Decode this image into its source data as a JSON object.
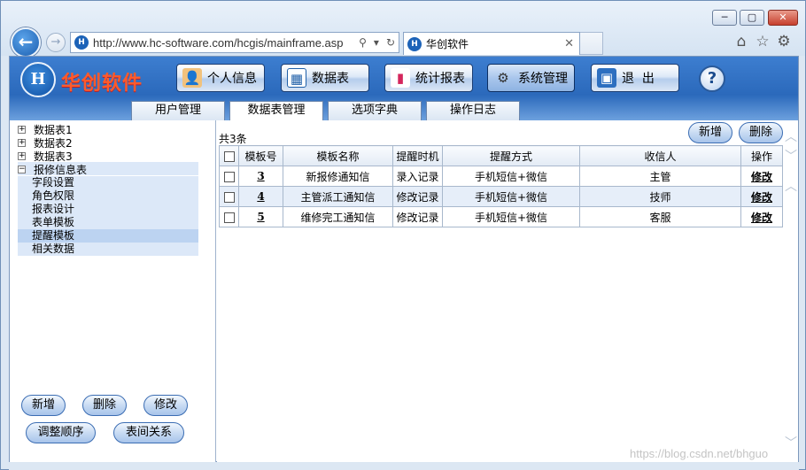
{
  "browser": {
    "url": "http://www.hc-software.com/hcgis/mainframe.asp",
    "favicon_text": "H",
    "tab_title": "华创软件",
    "tab_close": "✕",
    "window_controls": {
      "minimize": "─",
      "maximize": "▢",
      "close": "✕"
    },
    "icons": {
      "back": "←",
      "forward": "→",
      "search": "⚲",
      "dropdown": "▾",
      "refresh": "↻",
      "home": "⌂",
      "favorites": "☆",
      "settings": "⚙"
    }
  },
  "app": {
    "brand": "华创软件",
    "logo_text": "H",
    "nav": [
      {
        "label": "个人信息",
        "icon": "👤"
      },
      {
        "label": "数据表",
        "icon": "▦"
      },
      {
        "label": "统计报表",
        "icon": "▮"
      },
      {
        "label": "系统管理",
        "icon": "⚙"
      },
      {
        "label": "退  出",
        "icon": "▣"
      }
    ],
    "help": "?",
    "subtabs": [
      "用户管理",
      "数据表管理",
      "选项字典",
      "操作日志"
    ]
  },
  "tree": {
    "expand_symbol": "+",
    "collapse_symbol": "−",
    "items": [
      "数据表1",
      "数据表2",
      "数据表3",
      "报修信息表"
    ],
    "children": [
      "字段设置",
      "角色权限",
      "报表设计",
      "表单模板",
      "提醒模板",
      "相关数据"
    ]
  },
  "left_buttons": {
    "add": "新增",
    "delete": "删除",
    "edit": "修改",
    "reorder": "调整顺序",
    "relations": "表间关系"
  },
  "grid": {
    "count_text": "共3条",
    "add": "新增",
    "delete": "删除",
    "headers": [
      "模板号",
      "模板名称",
      "提醒时机",
      "提醒方式",
      "收信人",
      "操作"
    ],
    "rows": [
      {
        "id": "3",
        "name": "新报修通知信",
        "timing": "录入记录",
        "method": "手机短信+微信",
        "recipient": "主管",
        "action": "修改"
      },
      {
        "id": "4",
        "name": "主管派工通知信",
        "timing": "修改记录",
        "method": "手机短信+微信",
        "recipient": "技师",
        "action": "修改"
      },
      {
        "id": "5",
        "name": "维修完工通知信",
        "timing": "修改记录",
        "method": "手机短信+微信",
        "recipient": "客服",
        "action": "修改"
      }
    ]
  },
  "scroll": {
    "up": "︿",
    "down": "﹀"
  },
  "watermark": "https://blog.csdn.net/bhguo"
}
